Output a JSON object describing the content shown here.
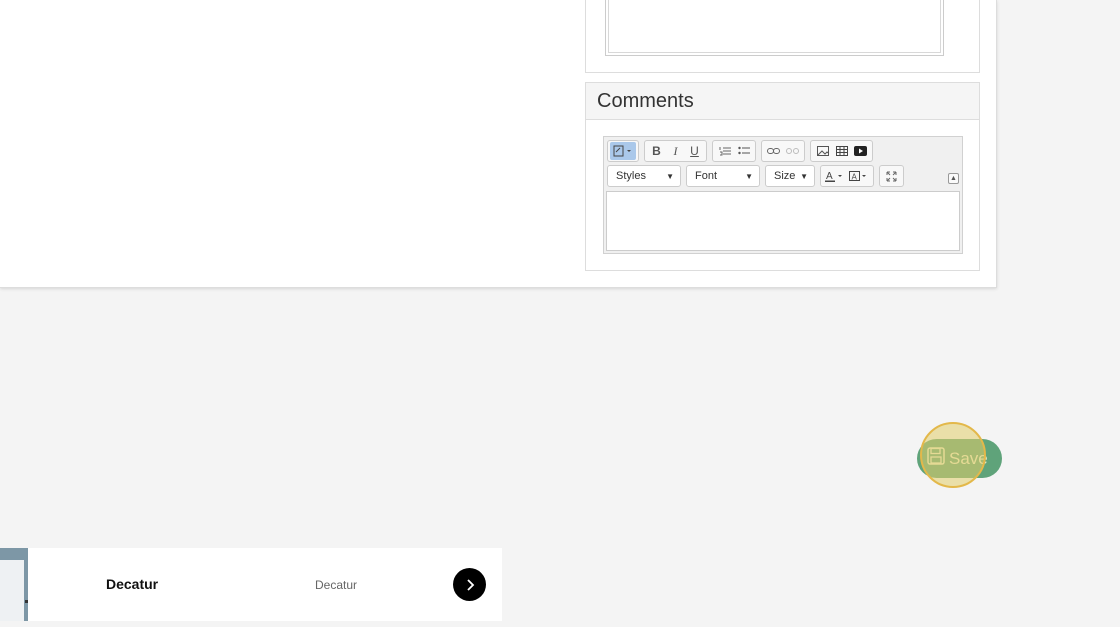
{
  "comments_panel": {
    "title": "Comments",
    "toolbar": {
      "styles_label": "Styles",
      "font_label": "Font",
      "size_label": "Size"
    }
  },
  "save_button": {
    "label": "Save"
  },
  "location_item": {
    "title": "Decatur",
    "subtitle": "Decatur"
  },
  "colors": {
    "save_green": "#5fa37a",
    "highlight": "#e3b84a"
  }
}
